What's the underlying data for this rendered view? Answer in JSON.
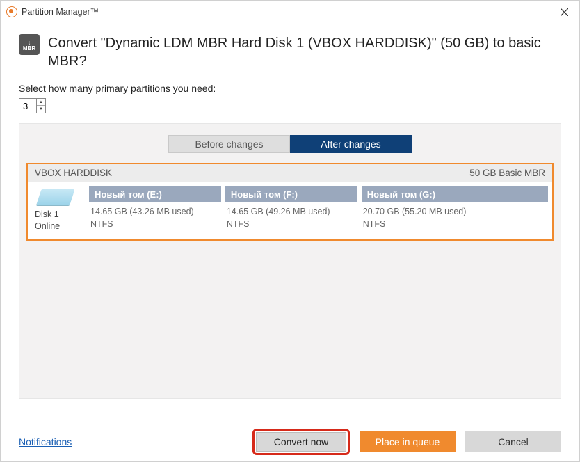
{
  "window": {
    "title": "Partition Manager™"
  },
  "header": {
    "icon_label": "MBR",
    "title": "Convert \"Dynamic LDM MBR Hard Disk 1 (VBOX HARDDISK)\" (50 GB) to basic MBR?"
  },
  "select": {
    "label": "Select how many primary partitions you need:",
    "value": "3"
  },
  "tabs": {
    "before": "Before changes",
    "after": "After changes"
  },
  "disk": {
    "name": "VBOX HARDDISK",
    "summary": "50 GB Basic MBR",
    "label": "Disk 1",
    "status": "Online"
  },
  "partitions": [
    {
      "title": "Новый том (E:)",
      "size_line": "14.65 GB (43.26 MB used)",
      "fs": "NTFS"
    },
    {
      "title": "Новый том (F:)",
      "size_line": "14.65 GB (49.26 MB used)",
      "fs": "NTFS"
    },
    {
      "title": "Новый том (G:)",
      "size_line": "20.70 GB (55.20 MB used)",
      "fs": "NTFS"
    }
  ],
  "footer": {
    "notifications": "Notifications",
    "convert": "Convert now",
    "queue": "Place in queue",
    "cancel": "Cancel"
  }
}
